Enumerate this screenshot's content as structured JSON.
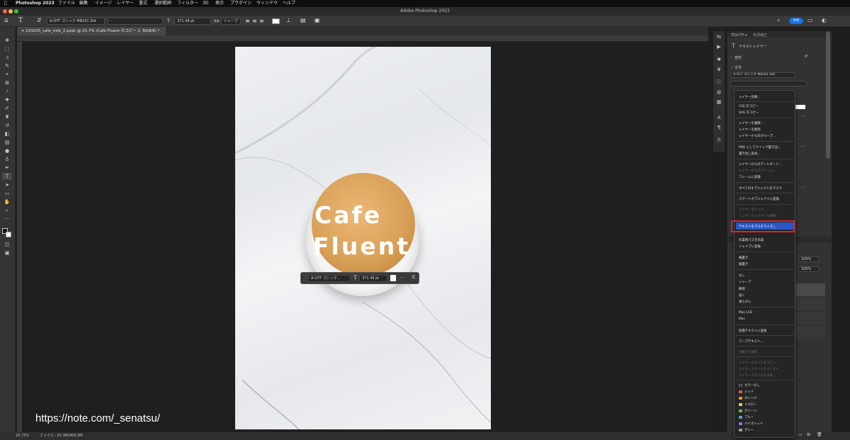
{
  "menubar": {
    "app": "Photoshop 2023",
    "items": [
      "ファイル",
      "編集",
      "イメージ",
      "レイヤー",
      "書式",
      "選択範囲",
      "フィルター",
      "3D",
      "表示",
      "プラグイン",
      "ウィンドウ",
      "ヘルプ"
    ]
  },
  "window": {
    "title": "Adobe Photoshop 2023",
    "share_label": "共有"
  },
  "options": {
    "font_family": "A-OTF ゴシック MB101 Std",
    "font_style": "-",
    "font_size": "371.48 pt",
    "antialias": "シャープ"
  },
  "document": {
    "tab_label": "231025_cafe_milk_2.psdc @ 20.7% (Cafe Fluent のコピー 2, RGB/8) *",
    "canvas_text_line1": "Cafe",
    "canvas_text_line2": "Fluent"
  },
  "floatbar": {
    "font": "A-OTF ゴシック...",
    "size": "371.48 pt",
    "more": "···"
  },
  "status": {
    "zoom": "20.73%",
    "file": "ファイル : 61.9M/400.9M"
  },
  "watermark": "https://note.com/_senatsu/",
  "properties": {
    "tab_properties": "プロパティ",
    "tab_adjust": "色調補正",
    "layer_type": "テキストレイヤー",
    "section_transform": "変形",
    "section_character": "文字",
    "font_family": "A-OTF ゴシック MB101 Std",
    "layers_opacity": "100%",
    "layers_fill": "100%"
  },
  "context_menu": {
    "items": [
      {
        "label": "レイヤー効果...",
        "enabled": true
      },
      {
        "label": "CSS をコピー",
        "enabled": true
      },
      {
        "label": "SVG をコピー",
        "enabled": true
      },
      {
        "label": "レイヤーを複製...",
        "enabled": true
      },
      {
        "label": "レイヤーを削除",
        "enabled": true
      },
      {
        "label": "レイヤーからのグループ...",
        "enabled": true
      },
      {
        "label": "PNG としてクイック書き出し",
        "enabled": true
      },
      {
        "label": "書き出し形式...",
        "enabled": true
      },
      {
        "label": "レイヤーからのアートボード...",
        "enabled": true
      },
      {
        "label": "レイヤーからのフレーム...",
        "enabled": false
      },
      {
        "label": "フレームに変換",
        "enabled": true
      },
      {
        "label": "すべてのオブジェクトをマスク",
        "enabled": true
      },
      {
        "label": "スマートオブジェクトに変換",
        "enabled": true
      },
      {
        "label": "レイヤーをリンク",
        "enabled": false
      },
      {
        "label": "リンクしたレイヤーを選択",
        "enabled": false
      },
      {
        "label": "テキストをラスタライズ",
        "enabled": true,
        "highlighted": true
      },
      {
        "label": "作業用パスを作成",
        "enabled": true
      },
      {
        "label": "シェイプに変換",
        "enabled": true
      },
      {
        "label": "横書き",
        "enabled": true
      },
      {
        "label": "縦書き",
        "enabled": true
      },
      {
        "label": "なし",
        "enabled": true
      },
      {
        "label": "シャープ",
        "enabled": true
      },
      {
        "label": "鮮明",
        "enabled": true
      },
      {
        "label": "強く",
        "enabled": true
      },
      {
        "label": "滑らかに",
        "enabled": true
      },
      {
        "label": "Mac LCD",
        "enabled": true
      },
      {
        "label": "Mac",
        "enabled": true
      },
      {
        "label": "段落テキストに変換",
        "enabled": true
      },
      {
        "label": "ワープテキスト...",
        "enabled": true
      },
      {
        "label": "分離から解除",
        "enabled": false
      },
      {
        "label": "レイヤースタイルをコピー",
        "enabled": false
      },
      {
        "label": "レイヤースタイルをペースト",
        "enabled": false
      },
      {
        "label": "レイヤースタイルを消去",
        "enabled": false
      }
    ],
    "colors": [
      {
        "label": "カラーなし",
        "color": "#1a1a1a"
      },
      {
        "label": "レッド",
        "color": "#e05a5a"
      },
      {
        "label": "オレンジ",
        "color": "#e8923a"
      },
      {
        "label": "イエロー",
        "color": "#e6cf3d"
      },
      {
        "label": "グリーン",
        "color": "#6fbf57"
      },
      {
        "label": "ブルー",
        "color": "#5a9fd8"
      },
      {
        "label": "バイオレット",
        "color": "#9b6fd4"
      },
      {
        "label": "グレー",
        "color": "#9a9a9a"
      }
    ]
  },
  "colors": {
    "accent": "#1473e6",
    "highlight": "#2a56c6",
    "callout": "#d8232f"
  }
}
